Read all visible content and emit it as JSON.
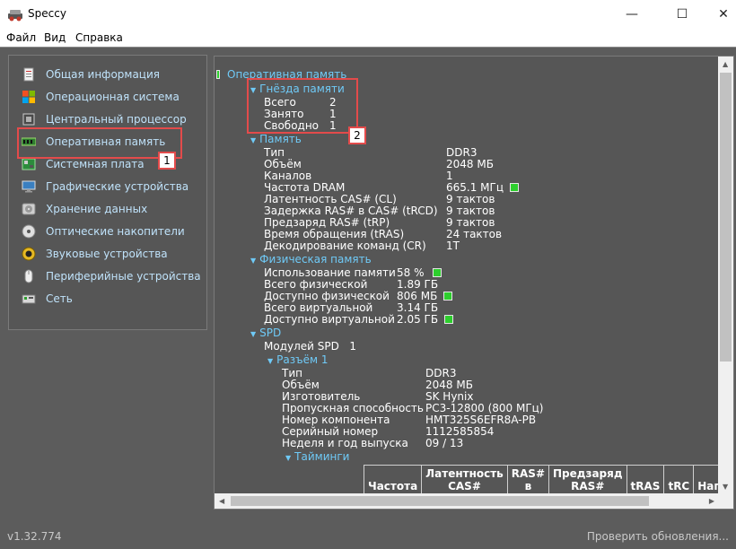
{
  "window": {
    "title": "Speccy",
    "minimize_glyph": "—",
    "maximize_glyph": "☐",
    "close_glyph": "✕"
  },
  "menu": {
    "file": "Файл",
    "view": "Вид",
    "help": "Справка"
  },
  "sidebar": {
    "items": [
      {
        "label": "Общая информация",
        "icon": "summary-icon"
      },
      {
        "label": "Операционная система",
        "icon": "windows-icon"
      },
      {
        "label": "Центральный процессор",
        "icon": "cpu-icon"
      },
      {
        "label": "Оперативная память",
        "icon": "ram-icon",
        "selected": true
      },
      {
        "label": "Системная плата",
        "icon": "motherboard-icon"
      },
      {
        "label": "Графические устройства",
        "icon": "monitor-icon"
      },
      {
        "label": "Хранение данных",
        "icon": "hdd-icon"
      },
      {
        "label": "Оптические накопители",
        "icon": "optical-disc-icon"
      },
      {
        "label": "Звуковые устройства",
        "icon": "speaker-icon"
      },
      {
        "label": "Периферийные устройства",
        "icon": "mouse-icon"
      },
      {
        "label": "Сеть",
        "icon": "network-icon"
      }
    ]
  },
  "ram": {
    "title": "Оперативная память",
    "slots": {
      "title": "Гнёзда памяти",
      "rows": [
        {
          "k": "Всего",
          "v": "2"
        },
        {
          "k": "Занято",
          "v": "1"
        },
        {
          "k": "Свободно",
          "v": "1"
        }
      ]
    },
    "memory": {
      "title": "Память",
      "rows": [
        {
          "k": "Тип",
          "v": "DDR3"
        },
        {
          "k": "Объём",
          "v": "2048 МБ"
        },
        {
          "k": "Каналов",
          "v": "1"
        },
        {
          "k": "Частота DRAM",
          "v": "665.1 МГц"
        },
        {
          "k": "Латентность CAS# (CL)",
          "v": "9 тактов"
        },
        {
          "k": "Задержка RAS# в CAS# (tRCD)",
          "v": "9 тактов"
        },
        {
          "k": "Предзаряд RAS# (tRP)",
          "v": "9 тактов"
        },
        {
          "k": "Время обращения (tRAS)",
          "v": "24 тактов"
        },
        {
          "k": "Декодирование команд (CR)",
          "v": "1T"
        }
      ]
    },
    "physical": {
      "title": "Физическая память",
      "rows": [
        {
          "k": "Использование памяти",
          "v": "58 %"
        },
        {
          "k": "Всего физической",
          "v": "1.89 ГБ"
        },
        {
          "k": "Доступно физической",
          "v": "806 МБ"
        },
        {
          "k": "Всего виртуальной",
          "v": "3.14 ГБ"
        },
        {
          "k": "Доступно виртуальной",
          "v": "2.05 ГБ"
        }
      ]
    },
    "spd": {
      "title": "SPD",
      "modules_label": "Модулей SPD",
      "modules_value": "1",
      "slot": {
        "title": "Разъём 1",
        "rows": [
          {
            "k": "Тип",
            "v": "DDR3"
          },
          {
            "k": "Объём",
            "v": "2048 МБ"
          },
          {
            "k": "Изготовитель",
            "v": "SK Hynix"
          },
          {
            "k": "Пропускная способность",
            "v": "PC3-12800 (800 МГц)"
          },
          {
            "k": "Номер компонента",
            "v": "HMT325S6EFR8A-PB"
          },
          {
            "k": "Серийный номер",
            "v": "1112585854"
          },
          {
            "k": "Неделя и год выпуска",
            "v": "09 / 13"
          }
        ],
        "timings_title": "Тайминги",
        "timings_headers": [
          "Частота",
          "Латентность CAS#",
          "RAS# в",
          "Предзаряд RAS#",
          "tRAS",
          "tRC",
          "Напр"
        ]
      }
    }
  },
  "callouts": {
    "one": "1",
    "two": "2"
  },
  "status": {
    "version": "v1.32.774",
    "update": "Проверить обновления..."
  }
}
